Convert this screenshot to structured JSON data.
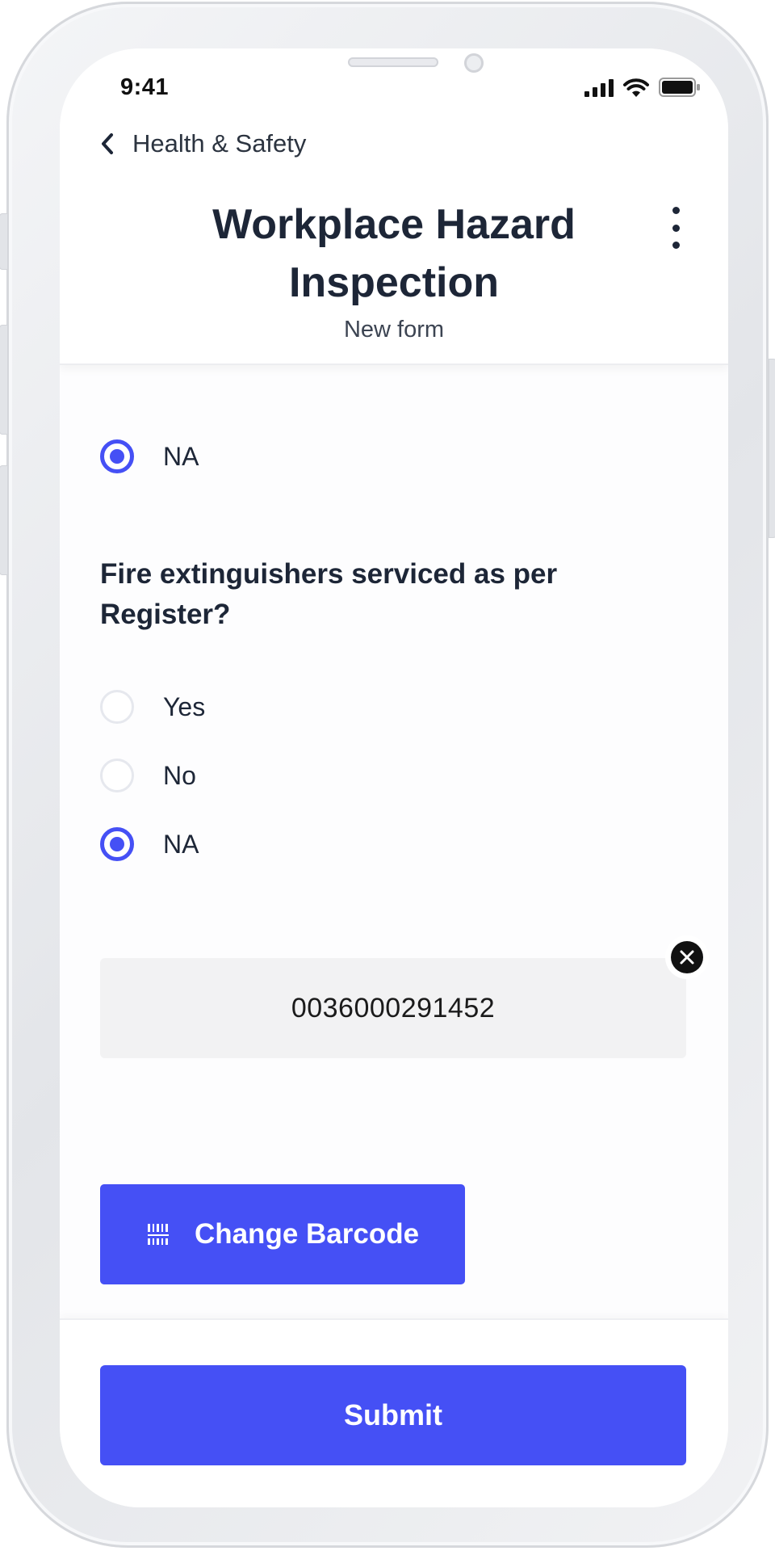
{
  "status_bar": {
    "time": "9:41",
    "icons": [
      "cellular-signal-icon",
      "wifi-icon",
      "battery-icon"
    ]
  },
  "header": {
    "back_label": "Health & Safety",
    "title_line1": "Workplace Hazard",
    "title_line2": "Inspection",
    "subtitle": "New form",
    "menu_icon": "more-vertical-icon"
  },
  "form": {
    "previous_question": {
      "visible_option": {
        "label": "NA",
        "selected": true
      }
    },
    "question": {
      "label_line1": "Fire extinguishers serviced as per",
      "label_line2": "Register?",
      "options": [
        {
          "label": "Yes",
          "selected": false
        },
        {
          "label": "No",
          "selected": false
        },
        {
          "label": "NA",
          "selected": true
        }
      ]
    },
    "barcode": {
      "value": "0036000291452",
      "clear_icon": "close-circle-icon"
    },
    "change_barcode_label": "Change Barcode",
    "change_barcode_icon": "barcode-icon"
  },
  "footer": {
    "submit_label": "Submit"
  },
  "colors": {
    "accent": "#4550f5",
    "title_text": "#1d2637"
  }
}
